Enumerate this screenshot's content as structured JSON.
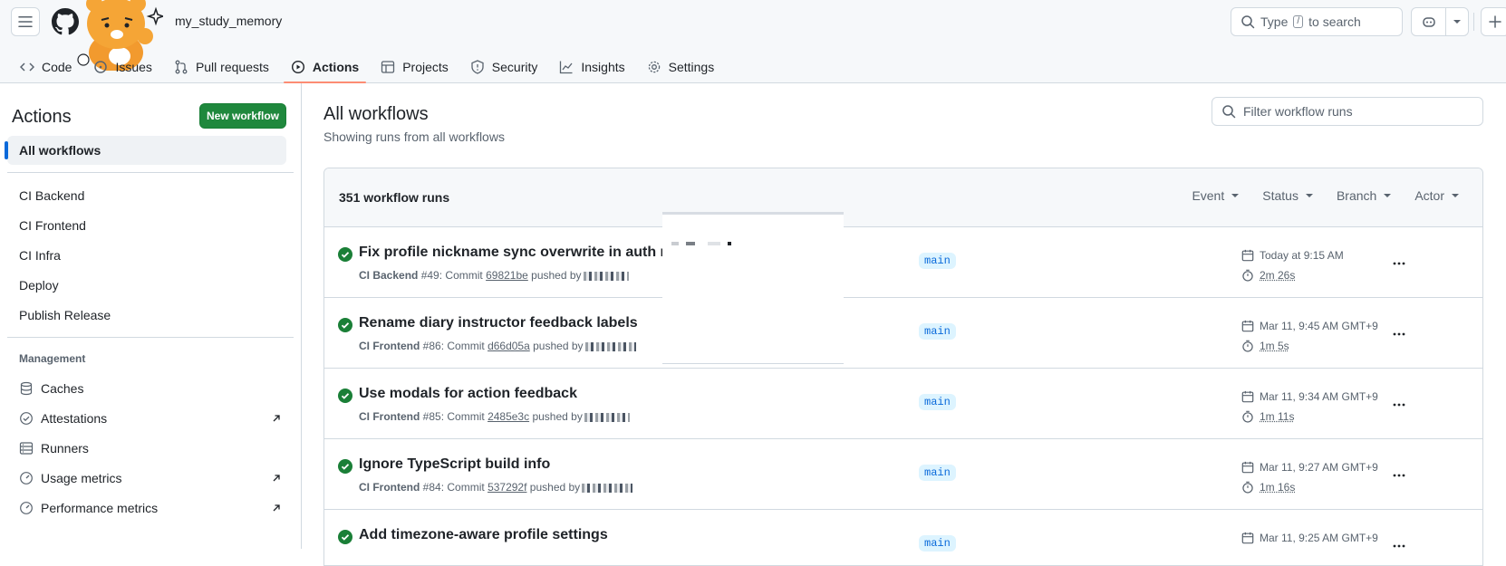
{
  "header": {
    "repo_name": "my_study_memory",
    "search_prefix": "Type",
    "search_key": "/",
    "search_suffix": "to search"
  },
  "tabs": [
    {
      "label": "Code",
      "icon": "code-icon"
    },
    {
      "label": "Issues",
      "icon": "issue-icon"
    },
    {
      "label": "Pull requests",
      "icon": "pull-request-icon"
    },
    {
      "label": "Actions",
      "icon": "play-icon",
      "active": true
    },
    {
      "label": "Projects",
      "icon": "table-icon"
    },
    {
      "label": "Security",
      "icon": "shield-icon"
    },
    {
      "label": "Insights",
      "icon": "graph-icon"
    },
    {
      "label": "Settings",
      "icon": "gear-icon"
    }
  ],
  "sidebar": {
    "title": "Actions",
    "new_workflow": "New workflow",
    "all_workflows": "All workflows",
    "workflows": [
      "CI Backend",
      "CI Frontend",
      "CI Infra",
      "Deploy",
      "Publish Release"
    ],
    "management_heading": "Management",
    "management": [
      {
        "label": "Caches",
        "icon": "database-icon"
      },
      {
        "label": "Attestations",
        "icon": "verified-icon",
        "external": true
      },
      {
        "label": "Runners",
        "icon": "server-icon"
      },
      {
        "label": "Usage metrics",
        "icon": "meter-icon",
        "external": true
      },
      {
        "label": "Performance metrics",
        "icon": "meter-icon",
        "external": true
      }
    ]
  },
  "main": {
    "title": "All workflows",
    "subtitle": "Showing runs from all workflows",
    "filter_placeholder": "Filter workflow runs",
    "runs_count": "351 workflow runs",
    "filters": [
      "Event",
      "Status",
      "Branch",
      "Actor"
    ],
    "runs": [
      {
        "title": "Fix profile nickname sync overwrite in auth mi",
        "workflow": "CI Backend",
        "number": "#49",
        "commit": "69821be",
        "branch": "main",
        "date": "Today at 9:15 AM",
        "duration": "2m 26s"
      },
      {
        "title": "Rename diary instructor feedback labels",
        "workflow": "CI Frontend",
        "number": "#86",
        "commit": "d66d05a",
        "branch": "main",
        "date": "Mar 11, 9:45 AM GMT+9",
        "duration": "1m 5s"
      },
      {
        "title": "Use modals for action feedback",
        "workflow": "CI Frontend",
        "number": "#85",
        "commit": "2485e3c",
        "branch": "main",
        "date": "Mar 11, 9:34 AM GMT+9",
        "duration": "1m 11s"
      },
      {
        "title": "Ignore TypeScript build info",
        "workflow": "CI Frontend",
        "number": "#84",
        "commit": "537292f",
        "branch": "main",
        "date": "Mar 11, 9:27 AM GMT+9",
        "duration": "1m 16s"
      },
      {
        "title": "Add timezone-aware profile settings",
        "workflow": "",
        "number": "",
        "commit": "",
        "branch": "main",
        "date": "Mar 11, 9:25 AM GMT+9",
        "duration": ""
      }
    ],
    "commit_word": "Commit",
    "pushed_word": "pushed by"
  },
  "colors": {
    "accent": "#0969da",
    "success": "#1a7f37",
    "tab_underline": "#fd8c73",
    "primary_button": "#1f883d"
  }
}
